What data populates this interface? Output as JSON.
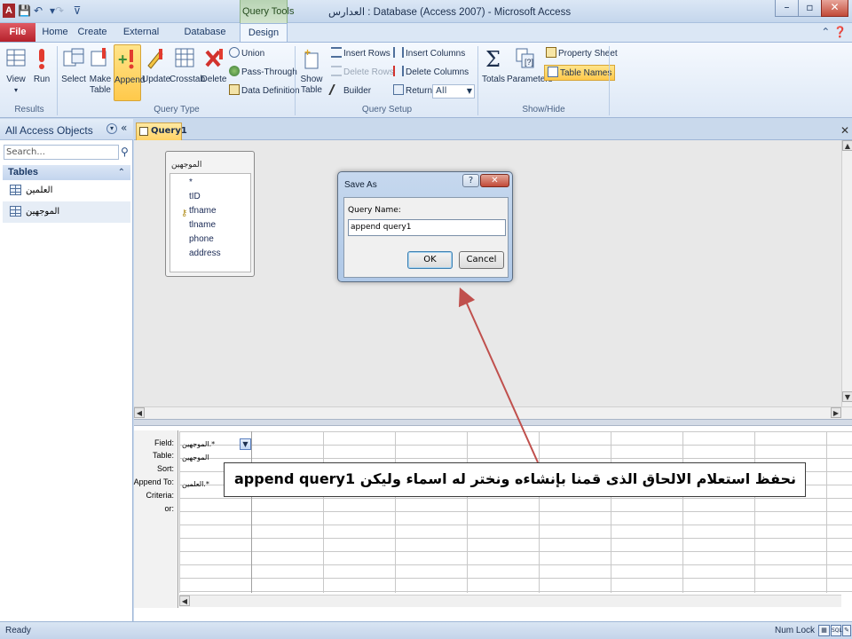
{
  "window": {
    "title": "العدارس : Database (Access 2007)  -  Microsoft Access",
    "contextual_tab": "Query Tools",
    "app_icon": "A",
    "controls": [
      "–",
      "▫",
      "✕"
    ]
  },
  "ribbon_tabs": {
    "file": "File",
    "home": "Home",
    "create": "Create",
    "external": "External Data",
    "dbtools": "Database Tools",
    "design": "Design"
  },
  "ribbon": {
    "results": {
      "label": "Results",
      "view": "View",
      "run": "Run"
    },
    "query_type": {
      "label": "Query Type",
      "select": "Select",
      "make_table": [
        "Make",
        "Table"
      ],
      "append": "Append",
      "update": "Update",
      "crosstab": "Crosstab",
      "delete": "Delete",
      "union": "Union",
      "pass_through": "Pass-Through",
      "data_definition": "Data Definition"
    },
    "query_setup": {
      "label": "Query Setup",
      "show_table": [
        "Show",
        "Table"
      ],
      "insert_rows": "Insert Rows",
      "delete_rows": "Delete Rows",
      "builder": "Builder",
      "insert_columns": "Insert Columns",
      "delete_columns": "Delete Columns",
      "return_label": "Return:",
      "return_value": "All"
    },
    "show_hide": {
      "label": "Show/Hide",
      "totals": "Totals",
      "parameters": "Parameters",
      "property_sheet": "Property Sheet",
      "table_names": "Table Names"
    }
  },
  "nav": {
    "title": "All Access Objects",
    "search_placeholder": "Search...",
    "group": "Tables",
    "items": [
      {
        "label": "العلمين"
      },
      {
        "label": "الموجهين"
      }
    ]
  },
  "document": {
    "tab_label": "Query1"
  },
  "field_list": {
    "title": "الموجهين",
    "fields": [
      "*",
      "tID",
      "tfname",
      "tlname",
      "phone",
      "address"
    ]
  },
  "dialog": {
    "title": "Save As",
    "help": "?",
    "close": "✕",
    "field_label": "Query Name:",
    "value": "append query1",
    "ok": "OK",
    "cancel": "Cancel"
  },
  "grid": {
    "row_labels": {
      "field": "Field:",
      "table": "Table:",
      "sort": "Sort:",
      "append_to": "Append To:",
      "criteria": "Criteria:",
      "or": "or:"
    },
    "col1": {
      "field": "الموجهين.*",
      "table": "الموجهين",
      "append_to": "العلمين.*"
    }
  },
  "annotation": {
    "text": "نحفظ استعلام الالحاق الذى قمنا بإنشاءه ونختر له اسماء وليكن append query1",
    "arrow_color": "#c0504d"
  },
  "statusbar": {
    "left": "Ready",
    "numlock": "Num Lock",
    "view_sql": "SQL"
  },
  "colors": {
    "accent_file_tab": "#b5212b",
    "contextual_green": "#b7d3b3",
    "highlight_button": "#ffc94b"
  }
}
